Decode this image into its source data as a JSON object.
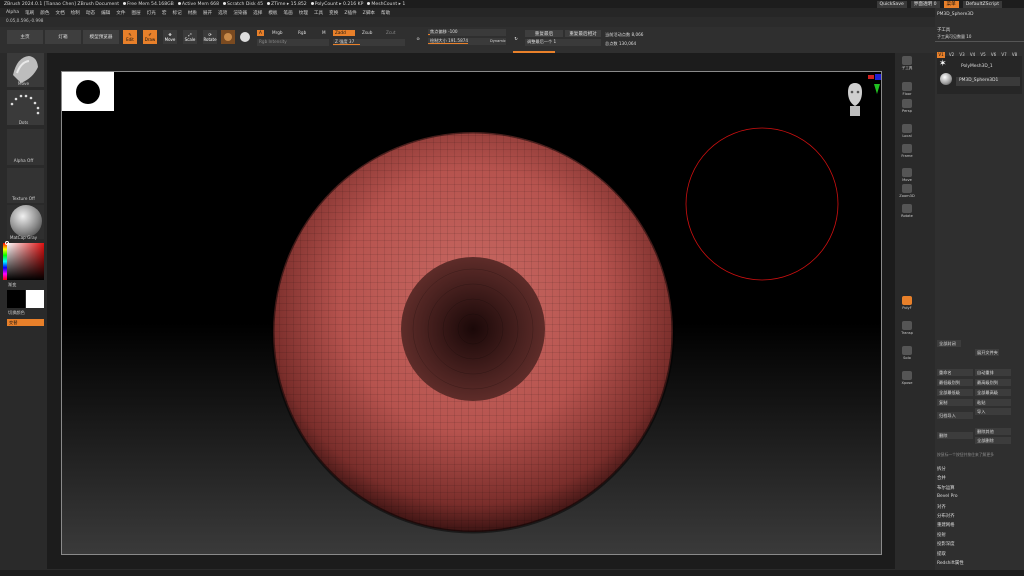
{
  "titlebar": {
    "app": "ZBrush 2024.0.1 [Tianao Chen]  ZBrush Document",
    "stats": [
      "Free Mem 54.168GB",
      "Active Mem 668",
      "Scratch Disk 45",
      "ZTime ▸ 15.852",
      "PolyCount ▸ 0.216 KP",
      "MeshCount ▸ 1"
    ],
    "right": {
      "ac": "菜单",
      "quicksave": "QuickSave",
      "transparency": "界面透明 0",
      "menu_btn": "菜单",
      "script": "DefaultZScript"
    }
  },
  "menubar": [
    "Alpha",
    "笔刷",
    "颜色",
    "文档",
    "绘制",
    "动态",
    "编辑",
    "文件",
    "图层",
    "灯光",
    "宏",
    "标记",
    "材质",
    "展开",
    "选项",
    "渲染器",
    "选择",
    "模板",
    "笔画",
    "纹理",
    "工具",
    "变换",
    "Z插件",
    "Z脚本",
    "帮助"
  ],
  "coord": "0.05,0.596,-0.998",
  "toolbar": {
    "home": "主页",
    "lightbox": "灯箱",
    "lightbox_tools": "模型预览器",
    "edit": "Edit",
    "draw": "Draw",
    "move": "Move",
    "scale": "Scale",
    "rotate": "Rotate",
    "a": "A",
    "mrgb": "Mrgb",
    "rgb": "Rgb",
    "m": "M",
    "zadd": "Zadd",
    "zsub": "Zsub",
    "zcut": "Zcut",
    "rgb_intensity": "Rgb Intensity",
    "z_intensity": "Z 强度 37",
    "focal_shift": "焦点偏移 -100",
    "draw_size": "绘制大小 191.5874",
    "dynamic": "Dynamic",
    "last_used": "重复最后",
    "repeat_relative": "重复最后相对",
    "adjust_last": "调整最后一个 1",
    "active_points": "当前活动点数 8,066",
    "total_points": "总点数 130,064"
  },
  "leftshelf": {
    "brush": "Move",
    "stroke": "Dots",
    "alpha": "Alpha Off",
    "texture": "Texture Off",
    "material": "MatCap Gray",
    "gradient": "渐变",
    "switch_color": "切换颜色",
    "alternate": "交替"
  },
  "rightshelf": [
    {
      "label": "子工具",
      "on": false
    },
    {
      "label": "Floor",
      "on": false
    },
    {
      "label": "Persp",
      "on": false
    },
    {
      "label": "Local",
      "on": false
    },
    {
      "label": "Frame",
      "on": false
    },
    {
      "label": "Move",
      "on": false
    },
    {
      "label": "Zoom3D",
      "on": false
    },
    {
      "label": "Rotate",
      "on": false
    },
    {
      "label": "PolyF",
      "on": true
    },
    {
      "label": "Transp",
      "on": false
    },
    {
      "label": "Solo",
      "on": false
    },
    {
      "label": "Xpose",
      "on": false
    }
  ],
  "rightpanel": {
    "current_tool": "PM3D_Sphere3D",
    "subtool_header": "子工具",
    "subtool_count": "子工具可见数量 10",
    "versions": [
      "V1",
      "V2",
      "V3",
      "V4",
      "V5",
      "V6",
      "V7",
      "V8"
    ],
    "items": [
      "PolyMesh3D_1",
      "PM3D_Sphere3D1"
    ],
    "buttons": [
      "全部封闭",
      "展开文件夹",
      "重命名",
      "自动重排",
      "最低级别到",
      "最高级别到",
      "全部最低级",
      "全部最高级",
      "复制",
      "粘贴",
      "归档导入",
      "导入",
      "删除",
      "删除其他",
      "全部删除"
    ],
    "menu": [
      "拆分",
      "合并",
      "布尔运算",
      "Bevel Pro",
      "对齐",
      "分布对齐",
      "重建网格",
      "投射",
      "投影深度",
      "提取",
      "Redshift属性"
    ],
    "hint": "按鼠标一个按钮并按住来了解更多"
  },
  "colors": {
    "accent": "#e8802a",
    "sphere": "#b6534e",
    "brush_ring": "#d01010"
  }
}
